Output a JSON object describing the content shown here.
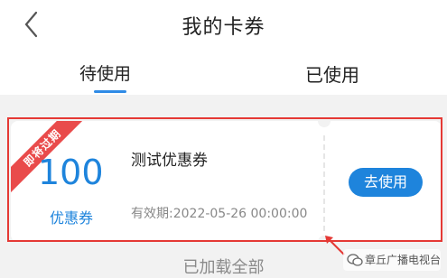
{
  "header": {
    "title": "我的卡券",
    "back_icon": "chevron-left-icon"
  },
  "tabs": [
    {
      "label": "待使用",
      "active": true
    },
    {
      "label": "已使用",
      "active": false
    }
  ],
  "coupon": {
    "ribbon": "即将过期",
    "amount": "100",
    "amount_label": "优惠券",
    "name": "测试优惠券",
    "expiry": "有效期:2022-05-26 00:00:00",
    "action_label": "去使用"
  },
  "footer": {
    "status": "已加载全部"
  },
  "watermark": {
    "text": "章丘广播电视台",
    "icon": "wechat-icon"
  },
  "colors": {
    "accent": "#1e84dc",
    "ribbon": "#e94b4b",
    "highlight_box": "#e53935"
  }
}
